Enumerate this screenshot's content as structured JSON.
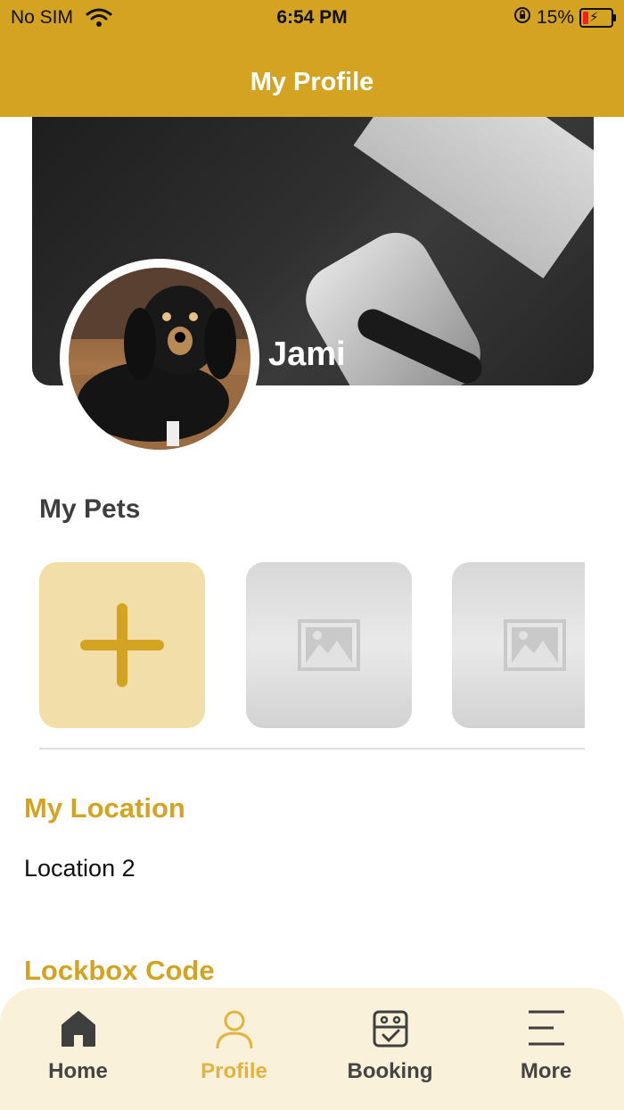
{
  "status_bar": {
    "carrier": "No SIM",
    "time": "6:54 PM",
    "battery_percent": "15%"
  },
  "header": {
    "title": "My Profile"
  },
  "profile": {
    "name": "Jami"
  },
  "pets": {
    "section_title": "My Pets",
    "cards": [
      {
        "type": "add",
        "icon": "plus-icon"
      },
      {
        "type": "placeholder",
        "icon": "image-placeholder-icon"
      },
      {
        "type": "placeholder",
        "icon": "image-placeholder-icon"
      }
    ]
  },
  "location": {
    "title": "My Location",
    "value": "Location 2"
  },
  "lockbox": {
    "title": "Lockbox Code"
  },
  "tabs": [
    {
      "label": "Home",
      "icon": "home-icon",
      "active": false
    },
    {
      "label": "Profile",
      "icon": "person-icon",
      "active": true
    },
    {
      "label": "Booking",
      "icon": "calendar-check-icon",
      "active": false
    },
    {
      "label": "More",
      "icon": "menu-icon",
      "active": false
    }
  ],
  "colors": {
    "brand": "#D4A322",
    "add_card": "#F2DEA9",
    "tab_bar": "#FAF1DA",
    "active_tab": "#E0B43E"
  }
}
